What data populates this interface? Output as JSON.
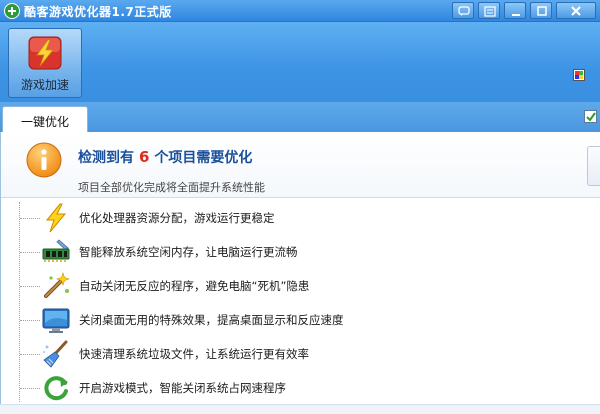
{
  "window": {
    "title": "酷客游戏优化器1.7正式版"
  },
  "toolbar": {
    "game_boost_label": "游戏加速"
  },
  "tabs": [
    {
      "label": "一键优化"
    }
  ],
  "summary": {
    "prefix": "检测到有",
    "count": "6",
    "suffix": "个项目需要优化",
    "description": "项目全部优化完成将全面提升系统性能"
  },
  "items": [
    {
      "text": "优化处理器资源分配，游戏运行更稳定",
      "icon": "lightning-icon"
    },
    {
      "text": "智能释放系统空闲内存，让电脑运行更流畅",
      "icon": "memory-icon"
    },
    {
      "text": "自动关闭无反应的程序，避免电脑“死机”隐患",
      "icon": "wand-icon"
    },
    {
      "text": "关闭桌面无用的特殊效果，提高桌面显示和反应速度",
      "icon": "desktop-icon"
    },
    {
      "text": "快速清理系统垃圾文件，让系统运行更有效率",
      "icon": "broom-icon"
    },
    {
      "text": "开启游戏模式，智能关闭系统占网速程序",
      "icon": "refresh-icon"
    }
  ],
  "colors": {
    "accent_blue": "#3d93e4",
    "headline_blue": "#1a4f9c",
    "count_red": "#e02a1b",
    "info_orange": "#f39a1f"
  }
}
